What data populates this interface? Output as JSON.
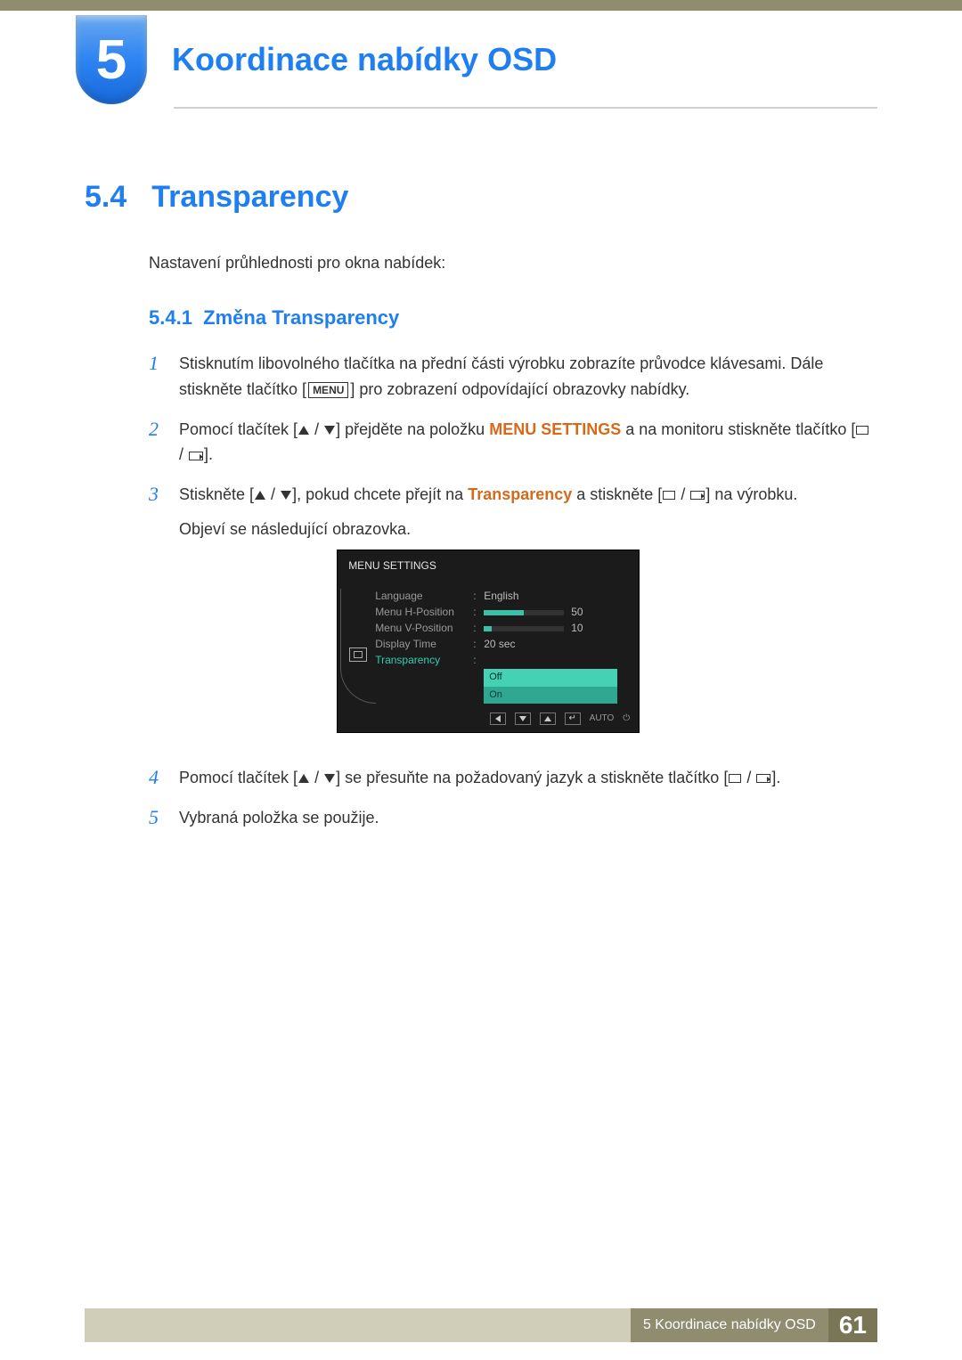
{
  "chapter": {
    "number": "5",
    "title": "Koordinace nabídky OSD"
  },
  "section": {
    "number": "5.4",
    "title": "Transparency"
  },
  "intro": "Nastavení průhlednosti pro okna nabídek:",
  "subsection": {
    "number": "5.4.1",
    "title": "Změna Transparency"
  },
  "steps": {
    "s1a": "Stisknutím libovolného tlačítka na přední části výrobku zobrazíte průvodce klávesami. Dále stiskněte tlačítko [",
    "s1b": "MENU",
    "s1c": "] pro zobrazení odpovídající obrazovky nabídky.",
    "s2a": "Pomocí tlačítek [",
    "s2b": "] přejděte na položku ",
    "s2c": "MENU SETTINGS",
    "s2d": " a na monitoru stiskněte tlačítko [",
    "s2e": "].",
    "s3a": "Stiskněte [",
    "s3b": "], pokud chcete přejít na ",
    "s3c": "Transparency",
    "s3d": " a stiskněte [",
    "s3e": "] na výrobku.",
    "s3f": "Objeví se následující obrazovka.",
    "s4a": "Pomocí tlačítek [",
    "s4b": "] se přesuňte na požadovaný jazyk a stiskněte tlačítko [",
    "s4c": "].",
    "s5": "Vybraná položka se použije."
  },
  "osd": {
    "title": "MENU SETTINGS",
    "rows": {
      "language": {
        "label": "Language",
        "value": "English"
      },
      "hpos": {
        "label": "Menu H-Position",
        "value": "50",
        "fill": 50
      },
      "vpos": {
        "label": "Menu V-Position",
        "value": "10",
        "fill": 10
      },
      "displayTime": {
        "label": "Display Time",
        "value": "20 sec"
      },
      "transparency": {
        "label": "Transparency",
        "options": [
          "Off",
          "On"
        ],
        "selected": "Off"
      }
    },
    "bottom": {
      "auto": "AUTO"
    }
  },
  "footer": {
    "text": "5 Koordinace nabídky OSD",
    "page": "61"
  }
}
